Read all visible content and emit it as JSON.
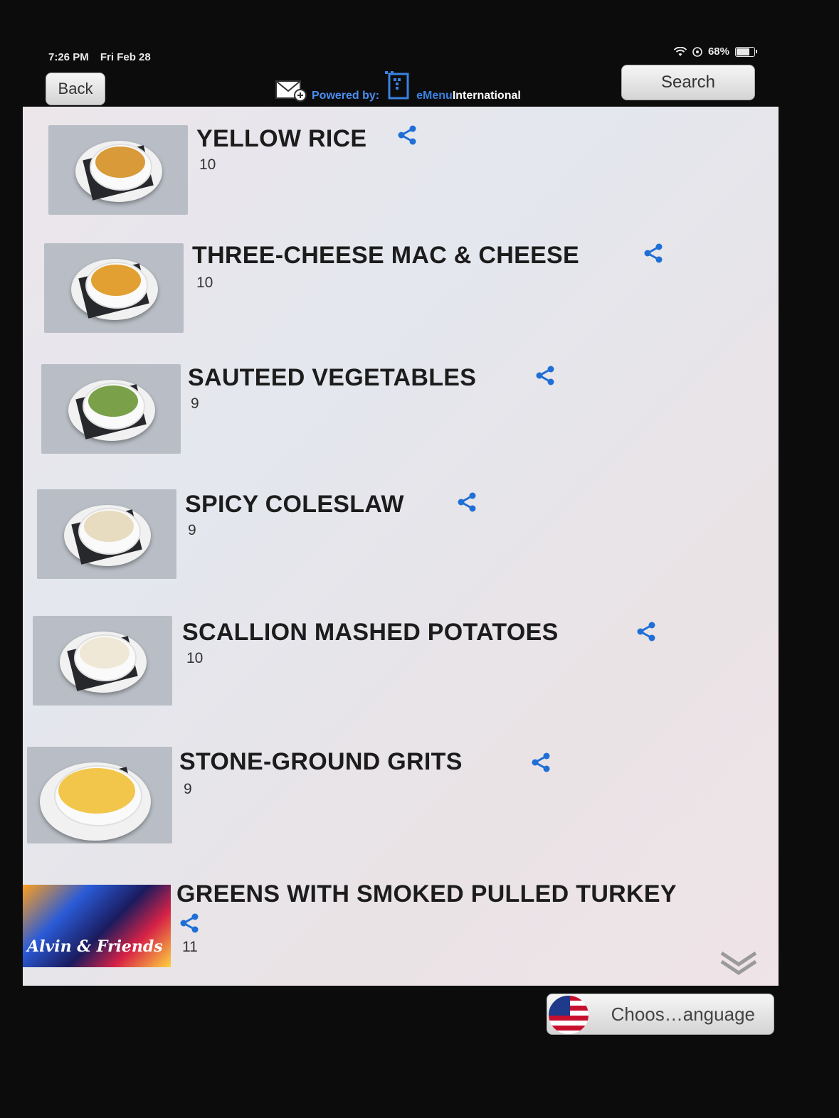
{
  "status": {
    "time": "7:26 PM",
    "date": "Fri Feb 28",
    "battery": "68%"
  },
  "header": {
    "back_label": "Back",
    "search_label": "Search",
    "powered_by": "Powered by:",
    "brand_prefix": "eMenu",
    "brand_suffix": "International"
  },
  "menu": {
    "items": [
      {
        "name": "YELLOW RICE",
        "price": "10",
        "food_color": "#d99a3a"
      },
      {
        "name": "THREE-CHEESE MAC & CHEESE",
        "price": "10",
        "food_color": "#e3a032"
      },
      {
        "name": "SAUTEED VEGETABLES",
        "price": "9",
        "food_color": "#7aa04a"
      },
      {
        "name": "SPICY COLESLAW",
        "price": "9",
        "food_color": "#e8dcc0"
      },
      {
        "name": "SCALLION MASHED POTATOES",
        "price": "10",
        "food_color": "#efe8d6"
      },
      {
        "name": "STONE-GROUND GRITS",
        "price": "9",
        "food_color": "#f2c64a"
      },
      {
        "name": "GREENS WITH SMOKED PULLED TURKEY",
        "price": "11"
      }
    ],
    "logo_text": "Alvin & Friends"
  },
  "footer": {
    "language_label": "Choos…anguage"
  },
  "colors": {
    "share_blue": "#1f6fd6"
  }
}
